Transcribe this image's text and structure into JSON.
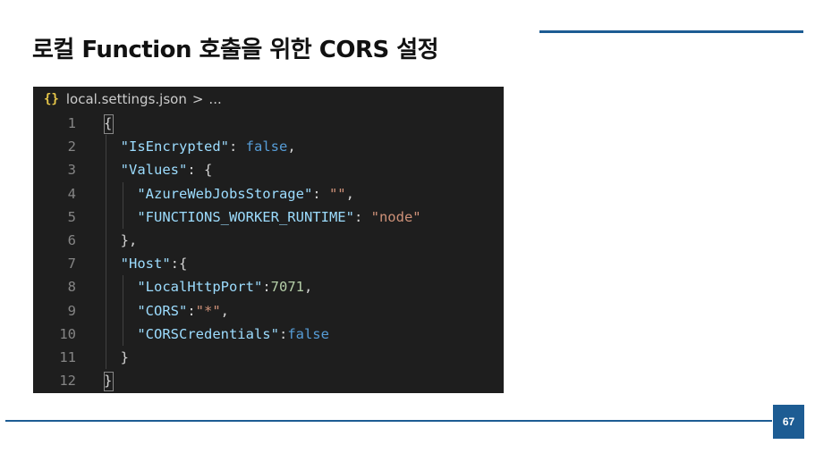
{
  "slide": {
    "title": "로컬 Function 호출을 위한 CORS 설정",
    "page_number": "67"
  },
  "editor": {
    "breadcrumb": {
      "icon": "json-braces-icon",
      "icon_glyph": "{}",
      "file": "local.settings.json",
      "separator": ">",
      "trail": "..."
    },
    "lines": [
      {
        "num": "1",
        "tokens": [
          {
            "t": "p",
            "v": "{"
          }
        ]
      },
      {
        "num": "2",
        "tokens": [
          {
            "t": "p",
            "v": "  "
          },
          {
            "t": "k",
            "v": "\"IsEncrypted\""
          },
          {
            "t": "p",
            "v": ": "
          },
          {
            "t": "b",
            "v": "false"
          },
          {
            "t": "p",
            "v": ","
          }
        ]
      },
      {
        "num": "3",
        "tokens": [
          {
            "t": "p",
            "v": "  "
          },
          {
            "t": "k",
            "v": "\"Values\""
          },
          {
            "t": "p",
            "v": ": {"
          }
        ]
      },
      {
        "num": "4",
        "tokens": [
          {
            "t": "p",
            "v": "    "
          },
          {
            "t": "k",
            "v": "\"AzureWebJobsStorage\""
          },
          {
            "t": "p",
            "v": ": "
          },
          {
            "t": "s",
            "v": "\"\""
          },
          {
            "t": "p",
            "v": ","
          }
        ]
      },
      {
        "num": "5",
        "tokens": [
          {
            "t": "p",
            "v": "    "
          },
          {
            "t": "k",
            "v": "\"FUNCTIONS_WORKER_RUNTIME\""
          },
          {
            "t": "p",
            "v": ": "
          },
          {
            "t": "s",
            "v": "\"node\""
          }
        ]
      },
      {
        "num": "6",
        "tokens": [
          {
            "t": "p",
            "v": "  },"
          }
        ]
      },
      {
        "num": "7",
        "tokens": [
          {
            "t": "p",
            "v": "  "
          },
          {
            "t": "k",
            "v": "\"Host\""
          },
          {
            "t": "p",
            "v": ":{"
          }
        ]
      },
      {
        "num": "8",
        "tokens": [
          {
            "t": "p",
            "v": "    "
          },
          {
            "t": "k",
            "v": "\"LocalHttpPort\""
          },
          {
            "t": "p",
            "v": ":"
          },
          {
            "t": "n",
            "v": "7071"
          },
          {
            "t": "p",
            "v": ","
          }
        ]
      },
      {
        "num": "9",
        "tokens": [
          {
            "t": "p",
            "v": "    "
          },
          {
            "t": "k",
            "v": "\"CORS\""
          },
          {
            "t": "p",
            "v": ":"
          },
          {
            "t": "s",
            "v": "\"*\""
          },
          {
            "t": "p",
            "v": ","
          }
        ]
      },
      {
        "num": "10",
        "tokens": [
          {
            "t": "p",
            "v": "    "
          },
          {
            "t": "k",
            "v": "\"CORSCredentials\""
          },
          {
            "t": "p",
            "v": ":"
          },
          {
            "t": "b",
            "v": "false"
          }
        ]
      },
      {
        "num": "11",
        "tokens": [
          {
            "t": "p",
            "v": "  }"
          }
        ]
      },
      {
        "num": "12",
        "tokens": [
          {
            "t": "p",
            "v": "}"
          }
        ]
      }
    ]
  },
  "colors": {
    "accent": "#1d5c93",
    "editor_bg": "#1e1e1e",
    "json_key": "#9cdcfe",
    "json_string": "#ce9178",
    "json_boolean": "#569cd6",
    "json_number": "#b5cea8",
    "punctuation": "#d4d4d4",
    "line_number": "#858585"
  }
}
